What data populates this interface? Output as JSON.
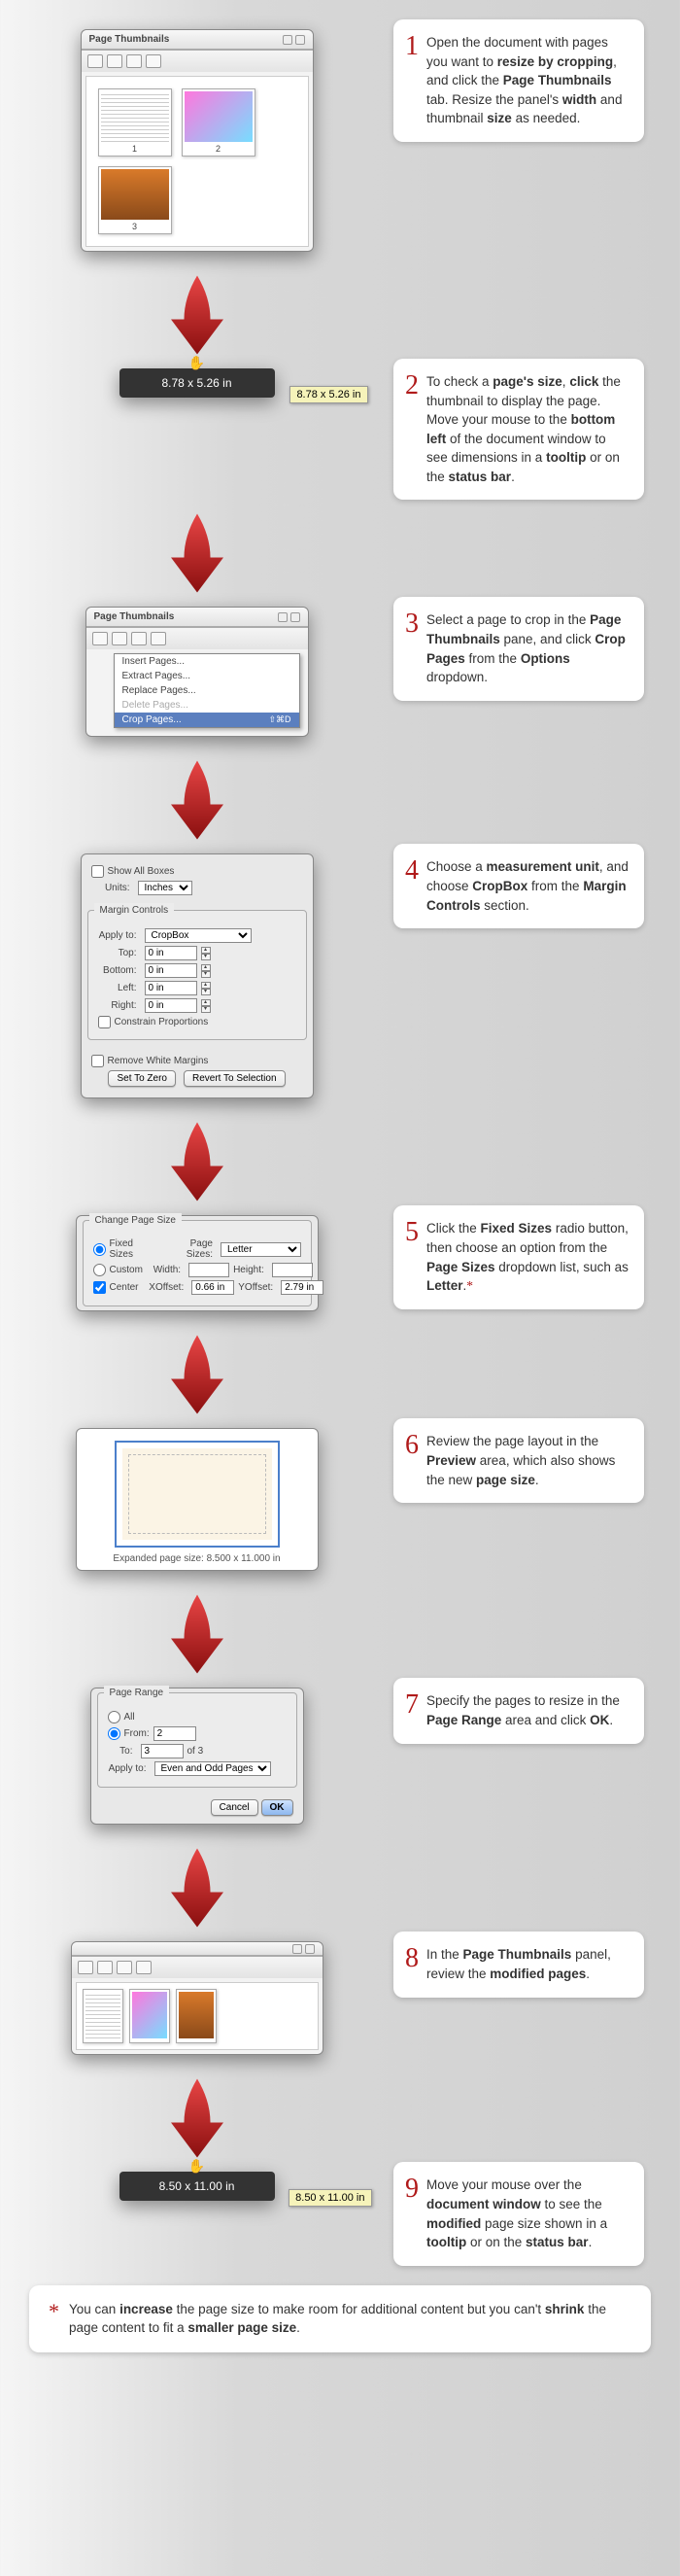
{
  "steps": [
    {
      "num": "1",
      "text_parts": [
        "Open the document with pages you want to ",
        "resize by cropping",
        ", and click the ",
        "Page Thumbnails",
        " tab. Resize the panel's ",
        "width",
        " and thumbnail ",
        "size",
        " as needed."
      ]
    },
    {
      "num": "2",
      "text_parts": [
        "To check a ",
        "page's size",
        ", ",
        "click",
        " the thumbnail to display the page. Move your mouse to the ",
        "bottom left",
        " of the document window to see dimensions in a ",
        "tooltip",
        " or on the ",
        "status bar",
        "."
      ]
    },
    {
      "num": "3",
      "text_parts": [
        "Select a page to crop in the ",
        "Page Thumbnails",
        " pane, and click ",
        "Crop Pages",
        " from the ",
        "Options",
        " dropdown."
      ]
    },
    {
      "num": "4",
      "text_parts": [
        "Choose a ",
        "measurement unit",
        ", and choose ",
        "CropBox",
        " from the ",
        "Margin Controls",
        " section."
      ]
    },
    {
      "num": "5",
      "text_parts": [
        "Click the ",
        "Fixed Sizes",
        " radio button, then choose an option from the ",
        "Page Sizes",
        " dropdown list, such as ",
        "Letter",
        ".",
        "*"
      ]
    },
    {
      "num": "6",
      "text_parts": [
        " Review the page layout in the ",
        "Preview",
        " area, which also shows the new ",
        "page size",
        "."
      ]
    },
    {
      "num": "7",
      "text_parts": [
        "Specify the pages to resize in the ",
        "Page Range",
        " area and click ",
        "OK",
        "."
      ]
    },
    {
      "num": "8",
      "text_parts": [
        "In the ",
        "Page Thumbnails",
        " panel, review the ",
        "modified pages",
        "."
      ]
    },
    {
      "num": "9",
      "text_parts": [
        "Move your mouse over the ",
        "document window",
        " to see the ",
        "modified",
        " page size shown in a ",
        "tooltip",
        " or on the ",
        "status bar",
        "."
      ]
    }
  ],
  "panel1": {
    "title": "Page Thumbnails",
    "thumbs": [
      "1",
      "2",
      "3"
    ]
  },
  "dim_before": "8.78 x 5.26 in",
  "dim_before_tip": "8.78 x 5.26 in",
  "panel3": {
    "title": "Page Thumbnails",
    "menu": [
      "Insert Pages...",
      "Extract Pages...",
      "Replace Pages...",
      "Delete Pages...",
      "Crop Pages..."
    ]
  },
  "dialog4": {
    "show_all": "Show All Boxes",
    "units_label": "Units:",
    "units_value": "Inches",
    "margin_title": "Margin Controls",
    "apply_label": "Apply to:",
    "apply_value": "CropBox",
    "top_label": "Top:",
    "top_value": "0 in",
    "bottom_label": "Bottom:",
    "bottom_value": "0 in",
    "left_label": "Left:",
    "left_value": "0 in",
    "right_label": "Right:",
    "right_value": "0 in",
    "constrain": "Constrain Proportions",
    "remove_white": "Remove White Margins",
    "zero_btn": "Set To Zero",
    "revert_btn": "Revert To Selection"
  },
  "dialog5": {
    "title": "Change Page Size",
    "fixed": "Fixed Sizes",
    "sizes_label": "Page Sizes:",
    "sizes_value": "Letter",
    "custom": "Custom",
    "width_label": "Width:",
    "height_label": "Height:",
    "center": "Center",
    "xoff_label": "XOffset:",
    "xoff_value": "0.66 in",
    "yoff_label": "YOffset:",
    "yoff_value": "2.79 in"
  },
  "preview_caption": "Expanded page size: 8.500 x 11.000 in",
  "dialog7": {
    "title": "Page Range",
    "all": "All",
    "from_label": "From:",
    "from_value": "2",
    "to_label": "To:",
    "to_value": "3",
    "of": "of 3",
    "apply_label": "Apply to:",
    "apply_value": "Even and Odd Pages",
    "cancel": "Cancel",
    "ok": "OK"
  },
  "dim_after": "8.50 x 11.00 in",
  "dim_after_tip": "8.50 x 11.00 in",
  "footnote": {
    "ast": "*",
    "parts": [
      "You can ",
      "increase",
      " the page size to make room for additional content but you can't ",
      "shrink",
      " the page content to fit a ",
      "smaller page size",
      "."
    ]
  }
}
